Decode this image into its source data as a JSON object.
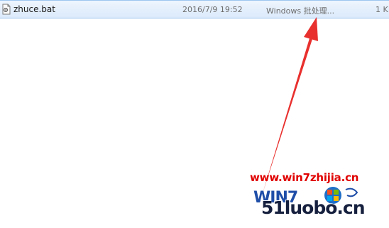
{
  "file_list": {
    "row": {
      "name": "zhuce.bat",
      "modified": "2016/7/9 19:52",
      "type": "Windows 批处理...",
      "size": "1 K",
      "icon": "batch-file-icon"
    }
  },
  "annotation": {
    "arrow_color": "#e8302e"
  },
  "watermark": {
    "url": "www.win7zhijia.cn",
    "logo_text": "WIN7",
    "brand": "51luobo.cn"
  },
  "colors": {
    "selection_bg": "#dbeafb",
    "selection_border": "#9dc5ef",
    "watermark_red": "#e00000",
    "watermark_navy": "#16203e"
  }
}
